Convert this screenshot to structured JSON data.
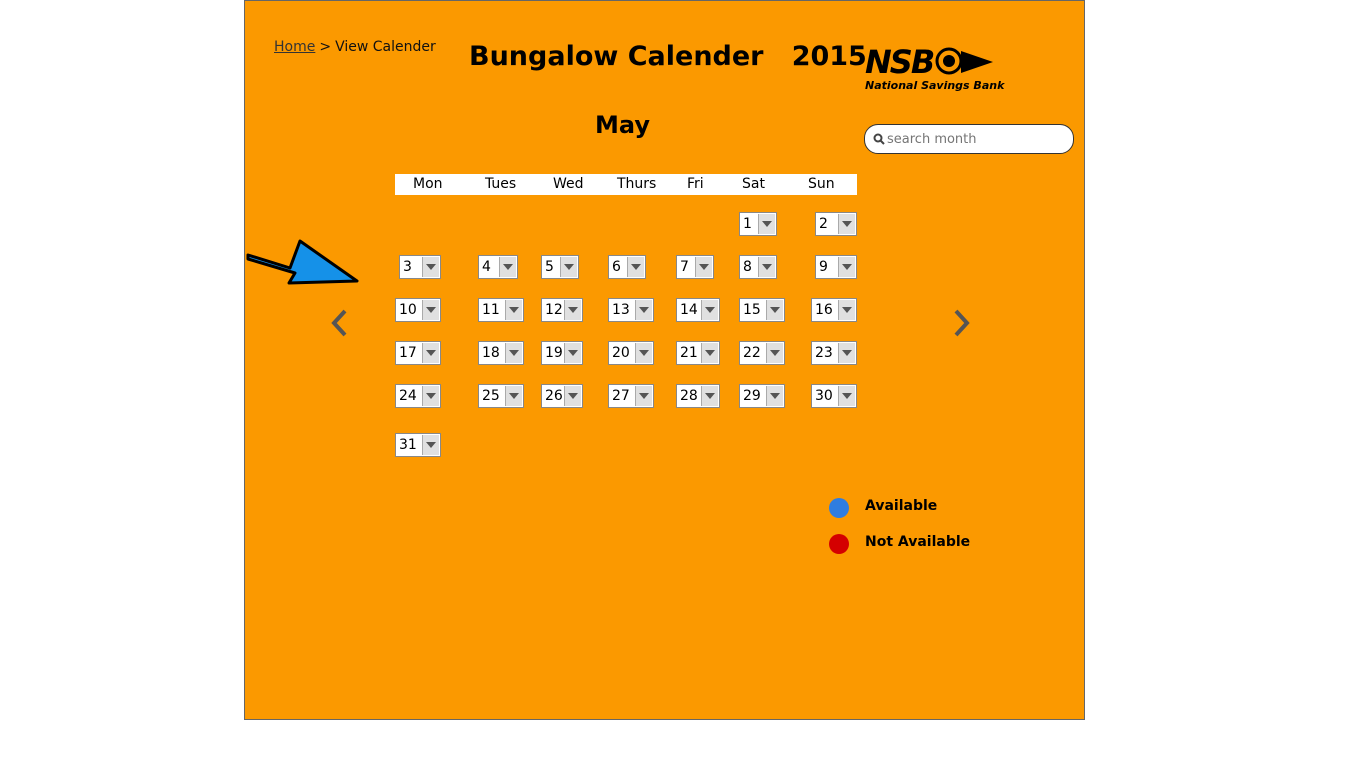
{
  "breadcrumb": {
    "home": "Home",
    "separator": ">",
    "current": "View Calender"
  },
  "title": "Bungalow Calender   2015",
  "month": "May",
  "logo": {
    "brand": "NSB",
    "subtitle": "National Savings Bank"
  },
  "search": {
    "placeholder": "search month",
    "value": ""
  },
  "weekdays": [
    "Mon",
    "Tues",
    "Wed",
    "Thurs",
    "Fri",
    "Sat",
    "Sun"
  ],
  "days": [
    "1",
    "2",
    "3",
    "4",
    "5",
    "6",
    "7",
    "8",
    "9",
    "10",
    "11",
    "12",
    "13",
    "14",
    "15",
    "16",
    "17",
    "18",
    "19",
    "20",
    "21",
    "22",
    "23",
    "24",
    "25",
    "26",
    "27",
    "28",
    "29",
    "30",
    "31"
  ],
  "legend": {
    "available": {
      "label": "Available",
      "color": "#2f7de0"
    },
    "not_available": {
      "label": "Not Available",
      "color": "#d40000"
    }
  },
  "colors": {
    "panel": "#fb9900",
    "arrow": "#1591e8"
  },
  "icons": {
    "prev": "chevron-left-icon",
    "next": "chevron-right-icon",
    "search": "search-icon"
  }
}
